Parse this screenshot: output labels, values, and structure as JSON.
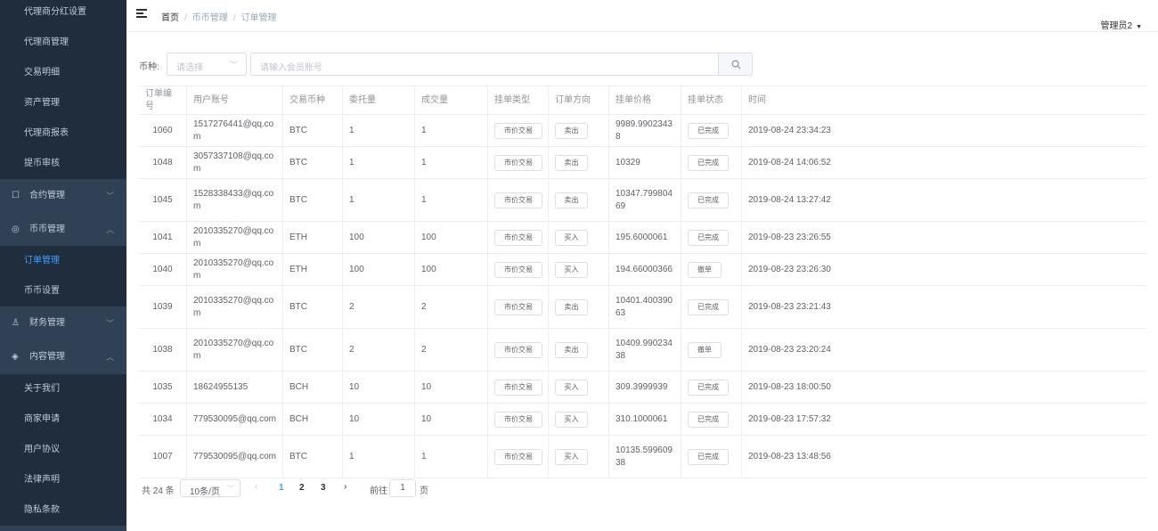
{
  "sidebar": {
    "items": [
      {
        "label": "代理商分红设置",
        "kind": "sub"
      },
      {
        "label": "代理商管理",
        "kind": "sub"
      },
      {
        "label": "交易明细",
        "kind": "sub"
      },
      {
        "label": "资产管理",
        "kind": "sub"
      },
      {
        "label": "代理商报表",
        "kind": "sub"
      },
      {
        "label": "提币审核",
        "kind": "sub"
      },
      {
        "label": "合约管理",
        "kind": "top",
        "icon": "contract-icon",
        "chevron": "﹀"
      },
      {
        "label": "币币管理",
        "kind": "top",
        "icon": "coin-icon",
        "chevron": "︿"
      },
      {
        "label": "订单管理",
        "kind": "sub",
        "active": true
      },
      {
        "label": "币币设置",
        "kind": "sub"
      },
      {
        "label": "财务管理",
        "kind": "top",
        "icon": "finance-icon",
        "chevron": "﹀"
      },
      {
        "label": "内容管理",
        "kind": "top",
        "icon": "content-icon",
        "chevron": "︿"
      },
      {
        "label": "关于我们",
        "kind": "sub"
      },
      {
        "label": "商家申请",
        "kind": "sub"
      },
      {
        "label": "用户协议",
        "kind": "sub"
      },
      {
        "label": "法律声明",
        "kind": "sub"
      },
      {
        "label": "隐私条款",
        "kind": "sub"
      }
    ]
  },
  "header": {
    "breadcrumb": [
      "首页",
      "币币管理",
      "订单管理"
    ],
    "user": "管理员2"
  },
  "filter": {
    "label": "币种:",
    "select_placeholder": "请选择",
    "search_placeholder": "请输入会员账号"
  },
  "table": {
    "columns": [
      "订单编号",
      "用户账号",
      "交易币种",
      "委托量",
      "成交量",
      "挂单类型",
      "订单方向",
      "挂单价格",
      "挂单状态",
      "时间"
    ],
    "rows": [
      {
        "id": "1060",
        "account": "1517276441@qq.com",
        "coin": "BTC",
        "entrust": "1",
        "deal": "1",
        "type": "市价交易",
        "dir": "卖出",
        "price": "9989.99023438",
        "status": "已完成",
        "time": "2019-08-24 23:34:23"
      },
      {
        "id": "1048",
        "account": "3057337108@qq.com",
        "coin": "BTC",
        "entrust": "1",
        "deal": "1",
        "type": "市价交易",
        "dir": "卖出",
        "price": "10329",
        "status": "已完成",
        "time": "2019-08-24 14:06:52"
      },
      {
        "id": "1045",
        "account": "1528338433@qq.com",
        "coin": "BTC",
        "entrust": "1",
        "deal": "1",
        "type": "市价交易",
        "dir": "卖出",
        "price": "10347.79980469",
        "status": "已完成",
        "time": "2019-08-24 13:27:42"
      },
      {
        "id": "1041",
        "account": "2010335270@qq.com",
        "coin": "ETH",
        "entrust": "100",
        "deal": "100",
        "type": "市价交易",
        "dir": "买入",
        "price": "195.6000061",
        "status": "已完成",
        "time": "2019-08-23 23:26:55"
      },
      {
        "id": "1040",
        "account": "2010335270@qq.com",
        "coin": "ETH",
        "entrust": "100",
        "deal": "100",
        "type": "市价交易",
        "dir": "买入",
        "price": "194.66000366",
        "status": "撤单",
        "time": "2019-08-23 23:26:30"
      },
      {
        "id": "1039",
        "account": "2010335270@qq.com",
        "coin": "BTC",
        "entrust": "2",
        "deal": "2",
        "type": "市价交易",
        "dir": "卖出",
        "price": "10401.40039063",
        "status": "已完成",
        "time": "2019-08-23 23:21:43"
      },
      {
        "id": "1038",
        "account": "2010335270@qq.com",
        "coin": "BTC",
        "entrust": "2",
        "deal": "2",
        "type": "市价交易",
        "dir": "卖出",
        "price": "10409.99023438",
        "status": "撤单",
        "time": "2019-08-23 23:20:24"
      },
      {
        "id": "1035",
        "account": "18624955135",
        "coin": "BCH",
        "entrust": "10",
        "deal": "10",
        "type": "市价交易",
        "dir": "买入",
        "price": "309.3999939",
        "status": "已完成",
        "time": "2019-08-23 18:00:50"
      },
      {
        "id": "1034",
        "account": "779530095@qq.com",
        "coin": "BCH",
        "entrust": "10",
        "deal": "10",
        "type": "市价交易",
        "dir": "买入",
        "price": "310.1000061",
        "status": "已完成",
        "time": "2019-08-23 17:57:32"
      },
      {
        "id": "1007",
        "account": "779530095@qq.com",
        "coin": "BTC",
        "entrust": "1",
        "deal": "1",
        "type": "市价交易",
        "dir": "买入",
        "price": "10135.59960938",
        "status": "已完成",
        "time": "2019-08-23 13:48:56"
      }
    ]
  },
  "pagination": {
    "total": "共 24 条",
    "page_size": "10条/页",
    "pages": [
      "1",
      "2",
      "3"
    ],
    "current": "1",
    "goto_prefix": "前往",
    "goto_value": "1",
    "goto_suffix": "页"
  },
  "colors": {
    "sidebar_bg": "#304156",
    "submenu_bg": "#1f2d3d",
    "active": "#409eff"
  }
}
